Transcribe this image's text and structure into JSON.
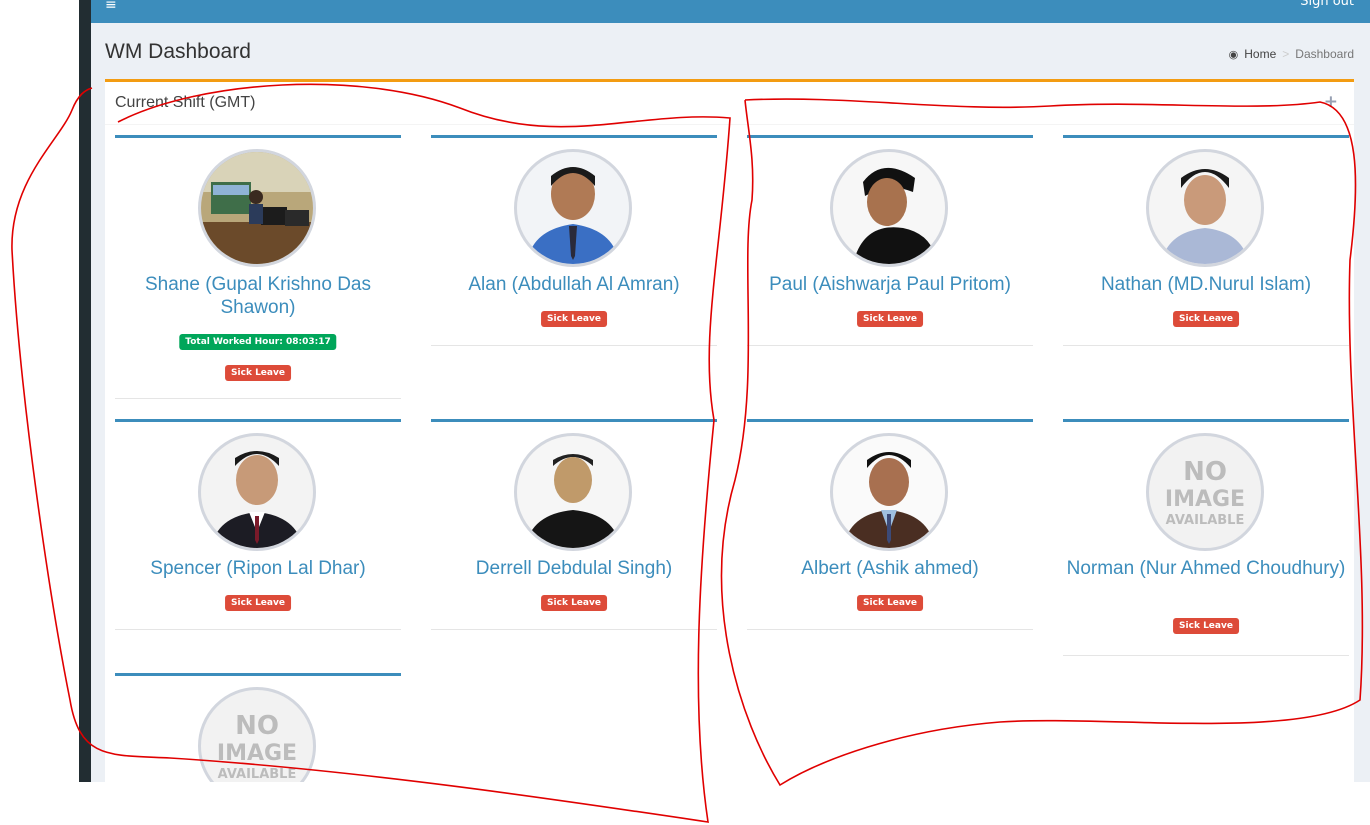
{
  "header": {
    "menu_icon": "hamburger-icon",
    "signout_label": "Sign out"
  },
  "page": {
    "title": "WM Dashboard"
  },
  "breadcrumb": {
    "icon": "dashboard-icon",
    "home": "Home",
    "current": "Dashboard"
  },
  "box": {
    "title": "Current Shift (GMT)",
    "tool_icon": "plus-icon",
    "tool_glyph": "+"
  },
  "colors": {
    "topbar": "#3c8dbc",
    "box_accent": "#f39c12",
    "name_link": "#3c8dbc",
    "leave_badge": "#dd4b39",
    "hours_badge": "#00a65a",
    "annotation": "#e00000"
  },
  "employees": [
    {
      "name": "Shane (Gupal Krishno Das Shawon)",
      "worked": "Total Worked Hour: 08:03:17",
      "status": "Sick Leave",
      "photo": "office-photo"
    },
    {
      "name": "Alan (Abdullah Al Amran)",
      "status": "Sick Leave",
      "photo": "portrait"
    },
    {
      "name": "Paul (Aishwarja Paul Pritom)",
      "status": "Sick Leave",
      "photo": "portrait"
    },
    {
      "name": "Nathan (MD.Nurul Islam)",
      "status": "Sick Leave",
      "photo": "portrait"
    },
    {
      "name": "Spencer (Ripon Lal Dhar)",
      "status": "Sick Leave",
      "photo": "portrait"
    },
    {
      "name": "Derrell Debdulal Singh)",
      "status": "Sick Leave",
      "photo": "portrait"
    },
    {
      "name": "Albert (Ashik ahmed)",
      "status": "Sick Leave",
      "photo": "portrait"
    },
    {
      "name": "Norman (Nur Ahmed Choudhury)",
      "status": "Sick Leave",
      "photo": "no-image"
    },
    {
      "name": "",
      "status": "",
      "photo": "no-image"
    }
  ],
  "no_image_text": [
    "NO",
    "IMAGE",
    "AVAILABLE"
  ]
}
